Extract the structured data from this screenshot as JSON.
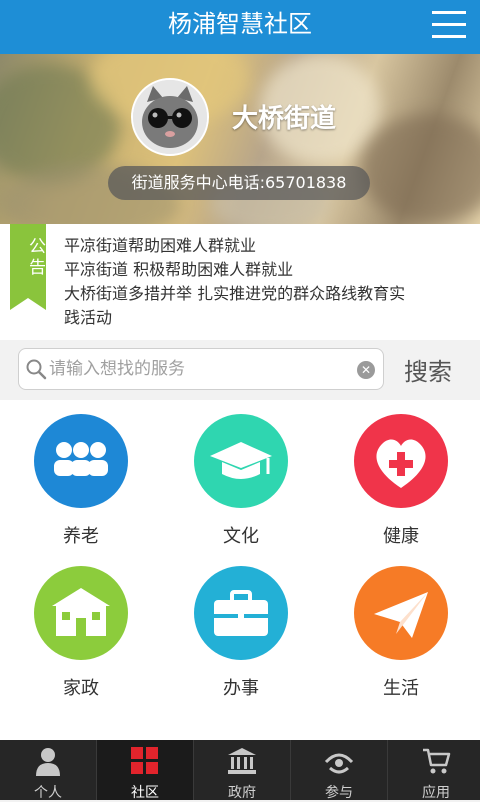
{
  "header": {
    "title": "杨浦智慧社区",
    "menu_icon": "menu-icon"
  },
  "hero": {
    "street_name": "大桥街道",
    "phone_label": "街道服务中心电话:65701838"
  },
  "notice": {
    "tag": "公告",
    "lines": [
      "平凉街道帮助困难人群就业",
      "平凉街道 积极帮助困难人群就业",
      "大桥街道多措并举 扎实推进党的群众路线教育实",
      "践活动"
    ]
  },
  "search": {
    "placeholder": "请输入想找的服务",
    "button": "搜索"
  },
  "services": [
    {
      "label": "养老",
      "icon": "people-icon",
      "color": "#1e88d6"
    },
    {
      "label": "文化",
      "icon": "graduation-cap-icon",
      "color": "#2fd6b0"
    },
    {
      "label": "健康",
      "icon": "heart-plus-icon",
      "color": "#f0344a"
    },
    {
      "label": "家政",
      "icon": "house-icon",
      "color": "#8ccc3c"
    },
    {
      "label": "办事",
      "icon": "briefcase-icon",
      "color": "#23b0d6"
    },
    {
      "label": "生活",
      "icon": "paper-plane-icon",
      "color": "#f67b26"
    }
  ],
  "tabs": [
    {
      "label": "个人",
      "icon": "person-icon"
    },
    {
      "label": "社区",
      "icon": "grid-icon",
      "active": true
    },
    {
      "label": "政府",
      "icon": "government-building-icon"
    },
    {
      "label": "参与",
      "icon": "participate-icon"
    },
    {
      "label": "应用",
      "icon": "cart-icon"
    }
  ],
  "colors": {
    "header": "#1e8ed6",
    "ribbon": "#8ac43c",
    "tabbar": "#262626",
    "tab_active_icon": "#e2242c"
  }
}
